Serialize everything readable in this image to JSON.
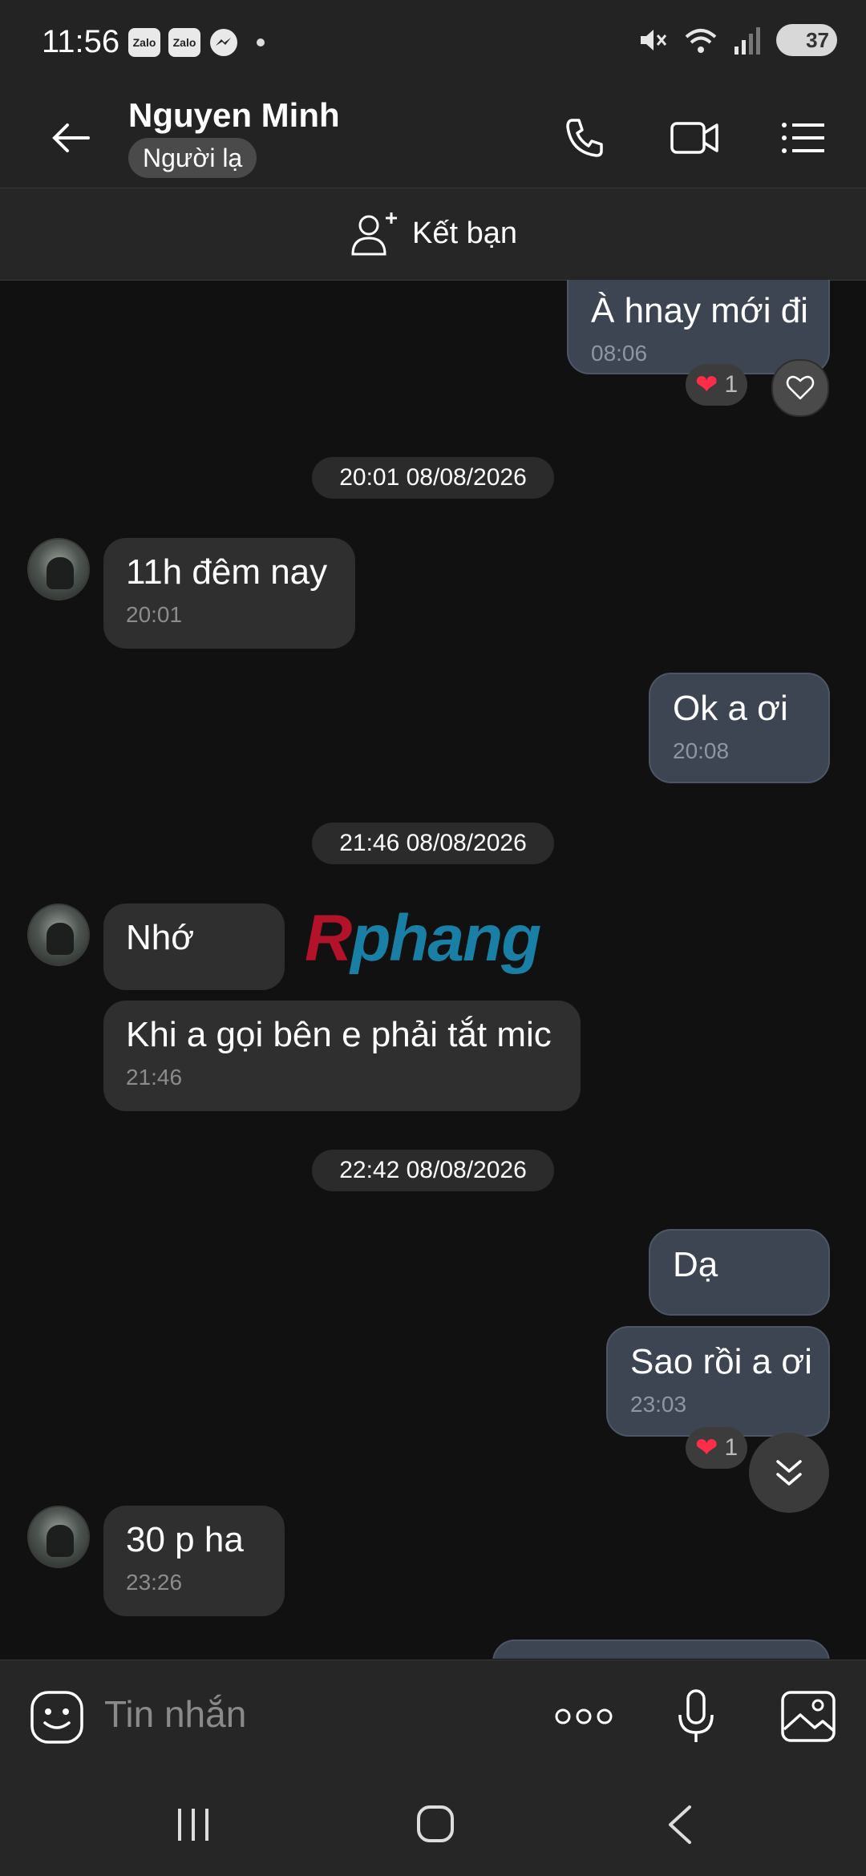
{
  "status_bar": {
    "time": "11:56",
    "app_badges": [
      "Zalo",
      "Zalo"
    ],
    "battery": "37",
    "icons": [
      "zalo-icon",
      "zalo-icon",
      "messenger-icon",
      "mute-icon",
      "wifi-icon",
      "signal-icon",
      "battery-icon"
    ]
  },
  "header": {
    "contact_name": "Nguyen Minh",
    "badge": "Người lạ",
    "icons": [
      "back-arrow-icon",
      "phone-icon",
      "video-call-icon",
      "menu-list-icon"
    ]
  },
  "add_friend": {
    "label": "Kết bạn",
    "icon": "add-user-icon"
  },
  "messages": [
    {
      "side": "out",
      "text": "À hnay mới đi",
      "time": "08:06",
      "reaction_count": "1"
    },
    {
      "type": "date",
      "text": "20:01 08/08/2026"
    },
    {
      "side": "in",
      "text": "11h đêm nay",
      "time": "20:01"
    },
    {
      "side": "out",
      "text": "Ok a ơi",
      "time": "20:08"
    },
    {
      "type": "date",
      "text": "21:46 08/08/2026"
    },
    {
      "side": "in",
      "text": "Nhớ",
      "time": ""
    },
    {
      "side": "in",
      "text": "Khi a gọi bên e phải tắt mic",
      "time": "21:46"
    },
    {
      "type": "date",
      "text": "22:42 08/08/2026"
    },
    {
      "side": "out",
      "text": "Dạ",
      "time": ""
    },
    {
      "side": "out",
      "text": "Sao rồi a ơi",
      "time": "23:03",
      "reaction_count": "1"
    },
    {
      "side": "in",
      "text": "30 p ha",
      "time": "23:26"
    }
  ],
  "watermark": {
    "first": "R",
    "rest": "phang"
  },
  "composer": {
    "placeholder": "Tin nhắn",
    "icons": [
      "sticker-icon",
      "more-icon",
      "microphone-icon",
      "image-icon"
    ]
  },
  "nav_bar": {
    "icons": [
      "recent-apps-icon",
      "home-icon",
      "back-icon"
    ]
  },
  "colors": {
    "background": "#111111",
    "incoming_bubble": "#2f2f2f",
    "outgoing_bubble": "#3d4553",
    "reaction_heart": "#ff2d4a"
  }
}
